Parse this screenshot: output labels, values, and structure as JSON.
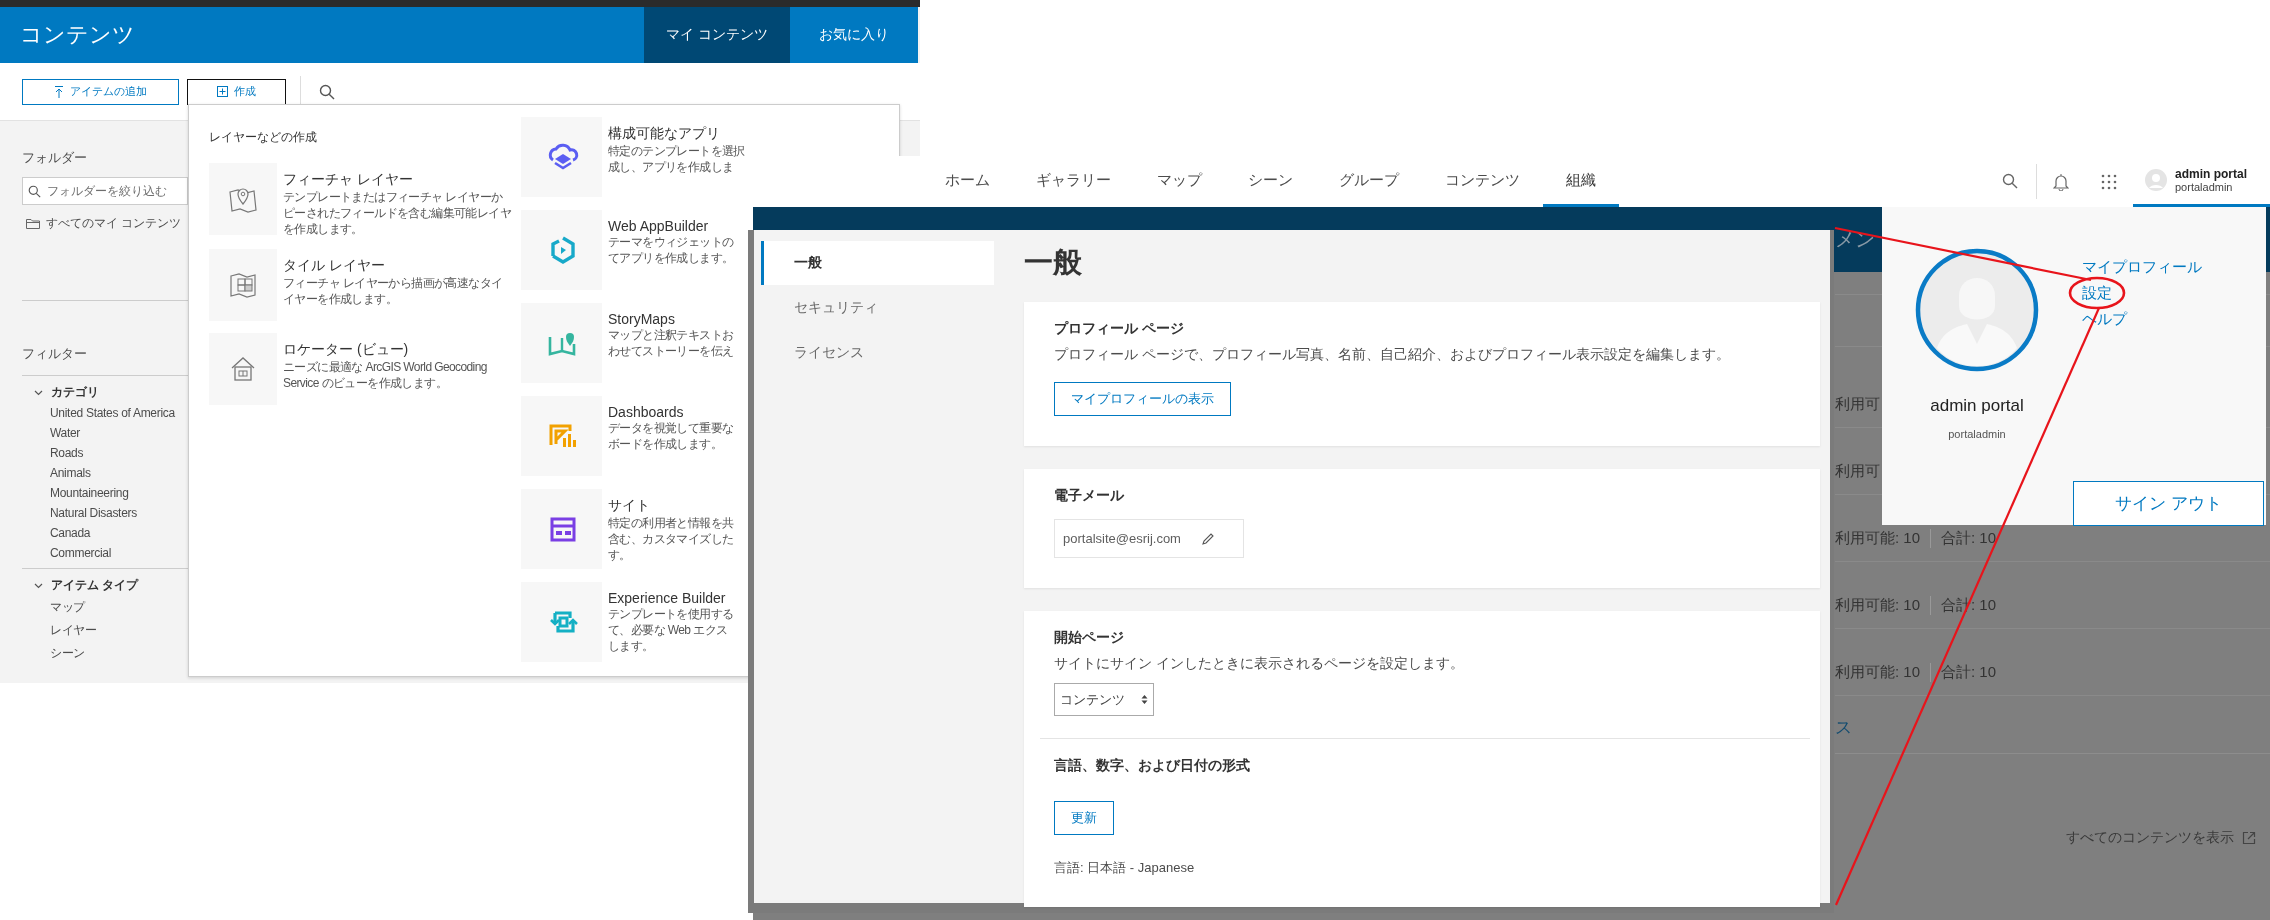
{
  "content_window": {
    "title": "コンテンツ",
    "tabs": [
      {
        "label": "マイ コンテンツ",
        "selected": true
      },
      {
        "label": "お気に入り",
        "selected": false
      }
    ],
    "add_button": "アイテムの追加",
    "create_button": {
      "label": "作成",
      "expanded": true
    },
    "folders": {
      "heading": "フォルダー",
      "filter_placeholder": "フォルダーを絞り込む",
      "items": [
        "すべてのマイ コンテンツ"
      ]
    },
    "filters": {
      "heading": "フィルター",
      "groups": [
        {
          "label": "カテゴリ",
          "expanded": true,
          "items": [
            "United States of America",
            "Water",
            "Roads",
            "Animals",
            "Mountaineering",
            "Natural Disasters",
            "Canada",
            "Commercial"
          ]
        },
        {
          "label": "アイテム タイプ",
          "expanded": true,
          "items": [
            "マップ",
            "レイヤー",
            "シーン"
          ]
        }
      ]
    },
    "create_menu": {
      "heading": "レイヤーなどの作成",
      "layers": [
        {
          "kind": "feature",
          "title": "フィーチャ レイヤー",
          "lines": [
            "テンプレートまたはフィーチャ レイヤーか",
            "ピーされたフィールドを含む編集可能レイヤ",
            "を作成します。"
          ]
        },
        {
          "kind": "tile",
          "title": "タイル レイヤー",
          "lines": [
            "フィーチャ レイヤーから描画が高速なタイ",
            "イヤーを作成します。"
          ]
        },
        {
          "kind": "locator",
          "title": "ロケーター (ビュー)",
          "lines": [
            "ニーズに最適な ArcGIS World Geocoding",
            "Service のビューを作成します。"
          ]
        }
      ],
      "apps": [
        {
          "kind": "configurable",
          "title": "構成可能なアプリ",
          "lines": [
            "特定のテンプレートを選択",
            "成し、アプリを作成しま"
          ]
        },
        {
          "kind": "appbuilder",
          "title": "Web AppBuilder",
          "lines": [
            "テーマをウィジェットの",
            "てアプリを作成します。"
          ]
        },
        {
          "kind": "storymap",
          "title": "StoryMaps",
          "lines": [
            "マップと注釈テキストお",
            "わせてストーリーを伝え"
          ]
        },
        {
          "kind": "dashboard",
          "title": "Dashboards",
          "lines": [
            "データを視覚して重要な",
            "ボードを作成します。"
          ]
        },
        {
          "kind": "site",
          "title": "サイト",
          "lines": [
            "特定の利用者と情報を共",
            "含む、カスタマイズした",
            "す。"
          ]
        },
        {
          "kind": "experience",
          "title": "Experience Builder",
          "lines": [
            "テンプレートを使用する",
            "て、必要な Web エクス",
            "します。"
          ]
        }
      ]
    }
  },
  "portal_window": {
    "nav": [
      {
        "label": "ホーム",
        "selected": false
      },
      {
        "label": "ギャラリー",
        "selected": false
      },
      {
        "label": "マップ",
        "selected": false
      },
      {
        "label": "シーン",
        "selected": false
      },
      {
        "label": "グループ",
        "selected": false
      },
      {
        "label": "コンテンツ",
        "selected": false
      },
      {
        "label": "組織",
        "selected": true
      }
    ],
    "user": {
      "name": "admin portal",
      "username": "portaladmin",
      "expanded": true
    },
    "banner_text": "メン",
    "rows": [
      {
        "available": "利用可"
      },
      {
        "available": "利用可"
      },
      {
        "available": "利用可能: 10",
        "total": "合計: 10"
      },
      {
        "available": "利用可能: 10",
        "total": "合計: 10"
      },
      {
        "available": "利用可能: 10",
        "total": "合計: 10"
      }
    ],
    "link": "ス",
    "view_all": "すべてのコンテンツを表示",
    "user_menu": {
      "name": "admin portal",
      "username": "portaladmin",
      "links": [
        {
          "label": "マイプロフィール",
          "highlighted": false
        },
        {
          "label": "設定",
          "highlighted": true
        },
        {
          "label": "ヘルプ",
          "highlighted": false
        }
      ],
      "sign_out": "サイン アウト"
    }
  },
  "settings_window": {
    "sidebar": [
      {
        "label": "一般",
        "selected": true
      },
      {
        "label": "セキュリティ",
        "selected": false
      },
      {
        "label": "ライセンス",
        "selected": false
      }
    ],
    "heading": "一般",
    "sections": [
      {
        "title": "プロフィール ページ",
        "description": "プロフィール ページで、プロフィール写真、名前、自己紹介、およびプロフィール表示設定を編集します。",
        "button": "マイプロフィールの表示"
      },
      {
        "title": "電子メール",
        "email": "portalsite@esrij.com"
      },
      {
        "title": "開始ページ",
        "description": "サイトにサイン インしたときに表示されるページを設定します。",
        "select": "コンテンツ",
        "subsection": {
          "title": "言語、数字、および日付の形式",
          "button": "更新",
          "language": "言語: 日本語 - Japanese"
        }
      }
    ]
  }
}
